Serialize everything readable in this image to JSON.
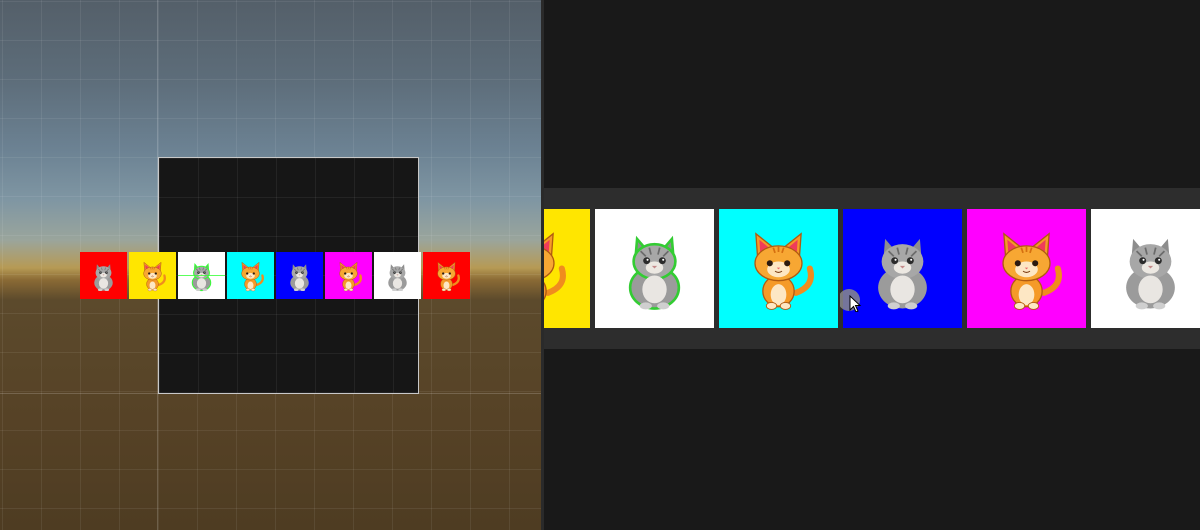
{
  "scene_view": {
    "strip_items": [
      {
        "bg": "#ff0000",
        "cat": "gray"
      },
      {
        "bg": "#ffe600",
        "cat": "orange"
      },
      {
        "bg": "#ffffff",
        "cat": "gray"
      },
      {
        "bg": "#00ffff",
        "cat": "orange"
      },
      {
        "bg": "#0000ff",
        "cat": "gray"
      },
      {
        "bg": "#ff00ff",
        "cat": "orange"
      },
      {
        "bg": "#ffffff",
        "cat": "gray"
      },
      {
        "bg": "#ff0000",
        "cat": "orange"
      }
    ],
    "selected_index": 2,
    "selection_color": "#33ff33"
  },
  "game_view": {
    "carousel_items": [
      {
        "bg": "#ffe600",
        "cat": "orange"
      },
      {
        "bg": "#ffffff",
        "cat": "gray"
      },
      {
        "bg": "#00ffff",
        "cat": "orange"
      },
      {
        "bg": "#0000ff",
        "cat": "gray"
      },
      {
        "bg": "#ff00ff",
        "cat": "orange"
      },
      {
        "bg": "#ffffff",
        "cat": "gray"
      }
    ],
    "selected_index": 1,
    "selection_color": "#33cc33"
  },
  "icons": {
    "gray_cat": "gray-cat-icon",
    "orange_cat": "orange-cat-icon",
    "cursor": "mouse-cursor-icon"
  }
}
